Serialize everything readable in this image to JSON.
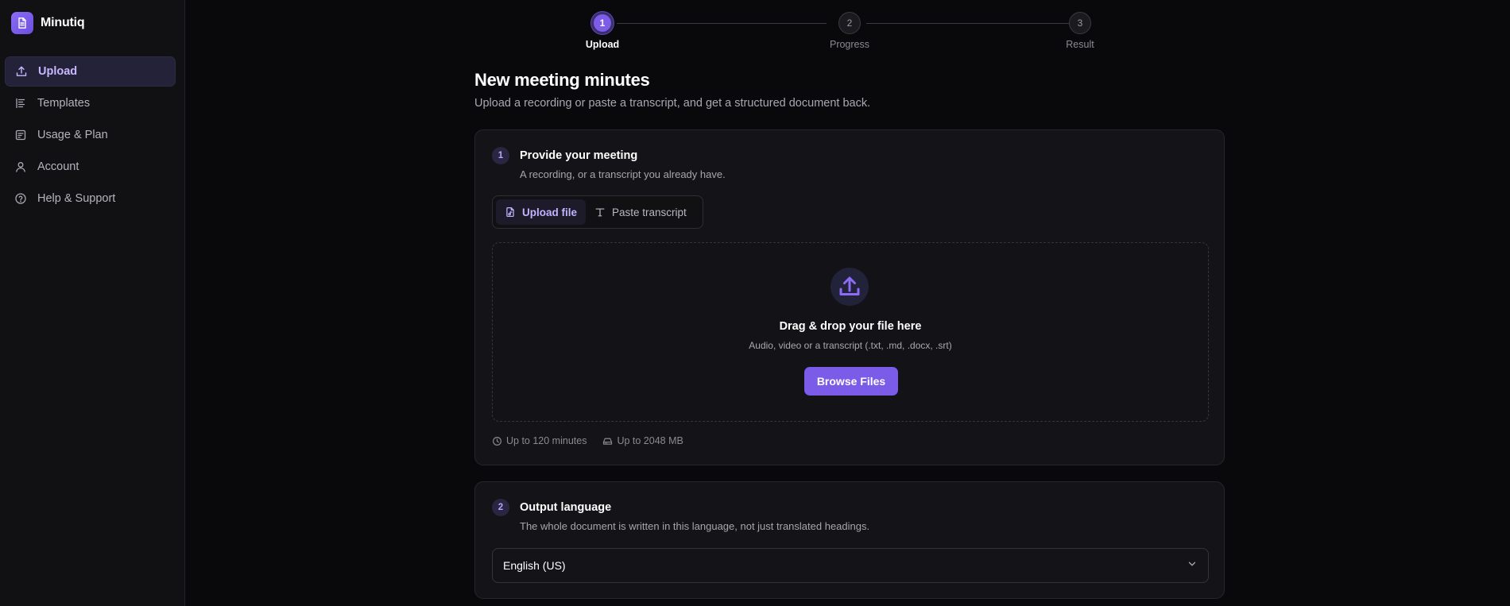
{
  "app": {
    "name": "Minutiq"
  },
  "sidebar": {
    "items": [
      {
        "label": "Upload",
        "icon": "upload-icon",
        "active": true
      },
      {
        "label": "Templates",
        "icon": "templates-icon",
        "active": false
      },
      {
        "label": "Usage & Plan",
        "icon": "receipt-icon",
        "active": false
      },
      {
        "label": "Account",
        "icon": "user-icon",
        "active": false
      },
      {
        "label": "Help & Support",
        "icon": "help-circle-icon",
        "active": false
      }
    ]
  },
  "stepper": {
    "steps": [
      {
        "number": "1",
        "label": "Upload",
        "active": true
      },
      {
        "number": "2",
        "label": "Progress",
        "active": false
      },
      {
        "number": "3",
        "label": "Result",
        "active": false
      }
    ]
  },
  "page": {
    "title": "New meeting minutes",
    "subtitle": "Upload a recording or paste a transcript, and get a structured document back."
  },
  "section1": {
    "number": "1",
    "title": "Provide your meeting",
    "description": "A recording, or a transcript you already have.",
    "tabs": [
      {
        "label": "Upload file",
        "icon": "file-audio-icon",
        "active": true
      },
      {
        "label": "Paste transcript",
        "icon": "text-icon",
        "active": false
      }
    ],
    "dropzone": {
      "title": "Drag & drop your file here",
      "subtitle": "Audio, video or a transcript (.txt, .md, .docx, .srt)",
      "button": "Browse Files"
    },
    "limits": {
      "duration": "Up to 120 minutes",
      "size": "Up to 2048 MB"
    }
  },
  "section2": {
    "number": "2",
    "title": "Output language",
    "description": "The whole document is written in this language, not just translated headings.",
    "select_value": "English (US)"
  },
  "colors": {
    "accent": "#7b5ce9",
    "background": "#09090c",
    "sidebar": "#111114",
    "card": "#141418"
  }
}
